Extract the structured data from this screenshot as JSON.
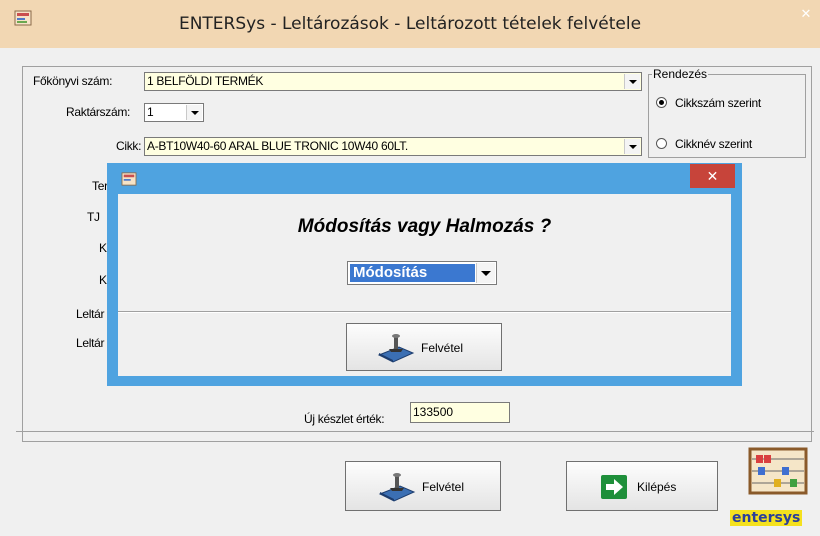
{
  "window": {
    "title": "ENTERSys - Leltározások - Leltározott tételek felvétele",
    "close_glyph": "✕",
    "app_icon": "app-icon"
  },
  "form": {
    "fokonyvi_label": "Főkönyvi szám:",
    "fokonyvi_value": "1  BELFÖLDI TERMÉK",
    "raktar_label": "Raktárszám:",
    "raktar_value": "1",
    "cikk_label": "Cikk:",
    "cikk_value": "A-BT10W40-60 ARAL BLUE TRONIC 10W40     60LT.",
    "partial_labels": [
      "Ter",
      "TJ",
      "Ke",
      "Ke",
      "Leltár",
      "Leltár"
    ],
    "uj_keszlet_label": "Új készlet érték:",
    "uj_keszlet_value": "133500"
  },
  "rendezes": {
    "title": "Rendezés",
    "options": [
      {
        "label": "Cikkszám szerint",
        "selected": true
      },
      {
        "label": "Cikknév szerint",
        "selected": false
      }
    ]
  },
  "buttons": {
    "felvetel_label": "Felvétel",
    "kilepes_label": "Kilépés"
  },
  "logo": {
    "text": "entersys"
  },
  "dialog": {
    "close_glyph": "✕",
    "question": "Módosítás vagy Halmozás ?",
    "select_value": "Módosítás",
    "button_label": "Felvétel"
  },
  "colors": {
    "titlebar": "#f2d7b3",
    "dialog_frame": "#4fa3e0",
    "dialog_close": "#c7443a",
    "field_bg": "#ffffe1",
    "select_highlight": "#3b78d0"
  }
}
